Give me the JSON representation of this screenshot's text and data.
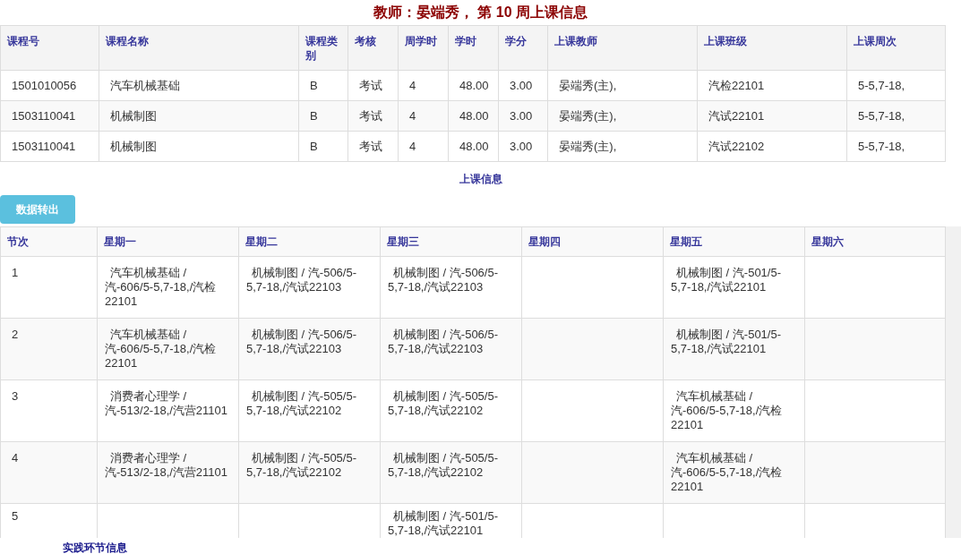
{
  "title": "教师：晏端秀， 第 10 周上课信息",
  "course_table": {
    "columns": [
      "课程号",
      "课程名称",
      "课程类别",
      "考核",
      "周学时",
      "学时",
      "学分",
      "上课教师",
      "上课班级",
      "上课周次"
    ],
    "rows": [
      [
        "1501010056",
        "汽车机械基础",
        "B",
        "考试",
        "4",
        "48.00",
        "3.00",
        "晏端秀(主),",
        "汽检22101",
        "5-5,7-18,"
      ],
      [
        "1503110041",
        "机械制图",
        "B",
        "考试",
        "4",
        "48.00",
        "3.00",
        "晏端秀(主),",
        "汽试22101",
        "5-5,7-18,"
      ],
      [
        "1503110041",
        "机械制图",
        "B",
        "考试",
        "4",
        "48.00",
        "3.00",
        "晏端秀(主),",
        "汽试22102",
        "5-5,7-18,"
      ]
    ]
  },
  "schedule_caption": "上课信息",
  "export_button": "数据转出",
  "schedule_table": {
    "columns": [
      "节次",
      "星期一",
      "星期二",
      "星期三",
      "星期四",
      "星期五",
      "星期六"
    ],
    "rows": [
      {
        "period": "1",
        "mon": "汽车机械基础 / 汽-606/5-5,7-18,/汽检22101",
        "tue": "机械制图 / 汽-506/5-5,7-18,/汽试22103",
        "wed": "机械制图 / 汽-506/5-5,7-18,/汽试22103",
        "fri": "机械制图 / 汽-501/5-5,7-18,/汽试22101"
      },
      {
        "period": "2",
        "mon": "汽车机械基础 / 汽-606/5-5,7-18,/汽检22101",
        "tue": "机械制图 / 汽-506/5-5,7-18,/汽试22103",
        "wed": "机械制图 / 汽-506/5-5,7-18,/汽试22103",
        "fri": "机械制图 / 汽-501/5-5,7-18,/汽试22101"
      },
      {
        "period": "3",
        "mon": "消费者心理学 / 汽-513/2-18,/汽营21101",
        "tue": "机械制图 / 汽-505/5-5,7-18,/汽试22102",
        "wed": "机械制图 / 汽-505/5-5,7-18,/汽试22102",
        "fri": "汽车机械基础 / 汽-606/5-5,7-18,/汽检22101"
      },
      {
        "period": "4",
        "mon": "消费者心理学 / 汽-513/2-18,/汽营21101",
        "tue": "机械制图 / 汽-505/5-5,7-18,/汽试22102",
        "wed": "机械制图 / 汽-505/5-5,7-18,/汽试22102",
        "fri": "汽车机械基础 / 汽-606/5-5,7-18,/汽检22101"
      },
      {
        "period": "5",
        "wed": "机械制图 / 汽-501/5-5,7-18,/汽试22101"
      }
    ]
  },
  "practice_caption": "实践环节信息"
}
